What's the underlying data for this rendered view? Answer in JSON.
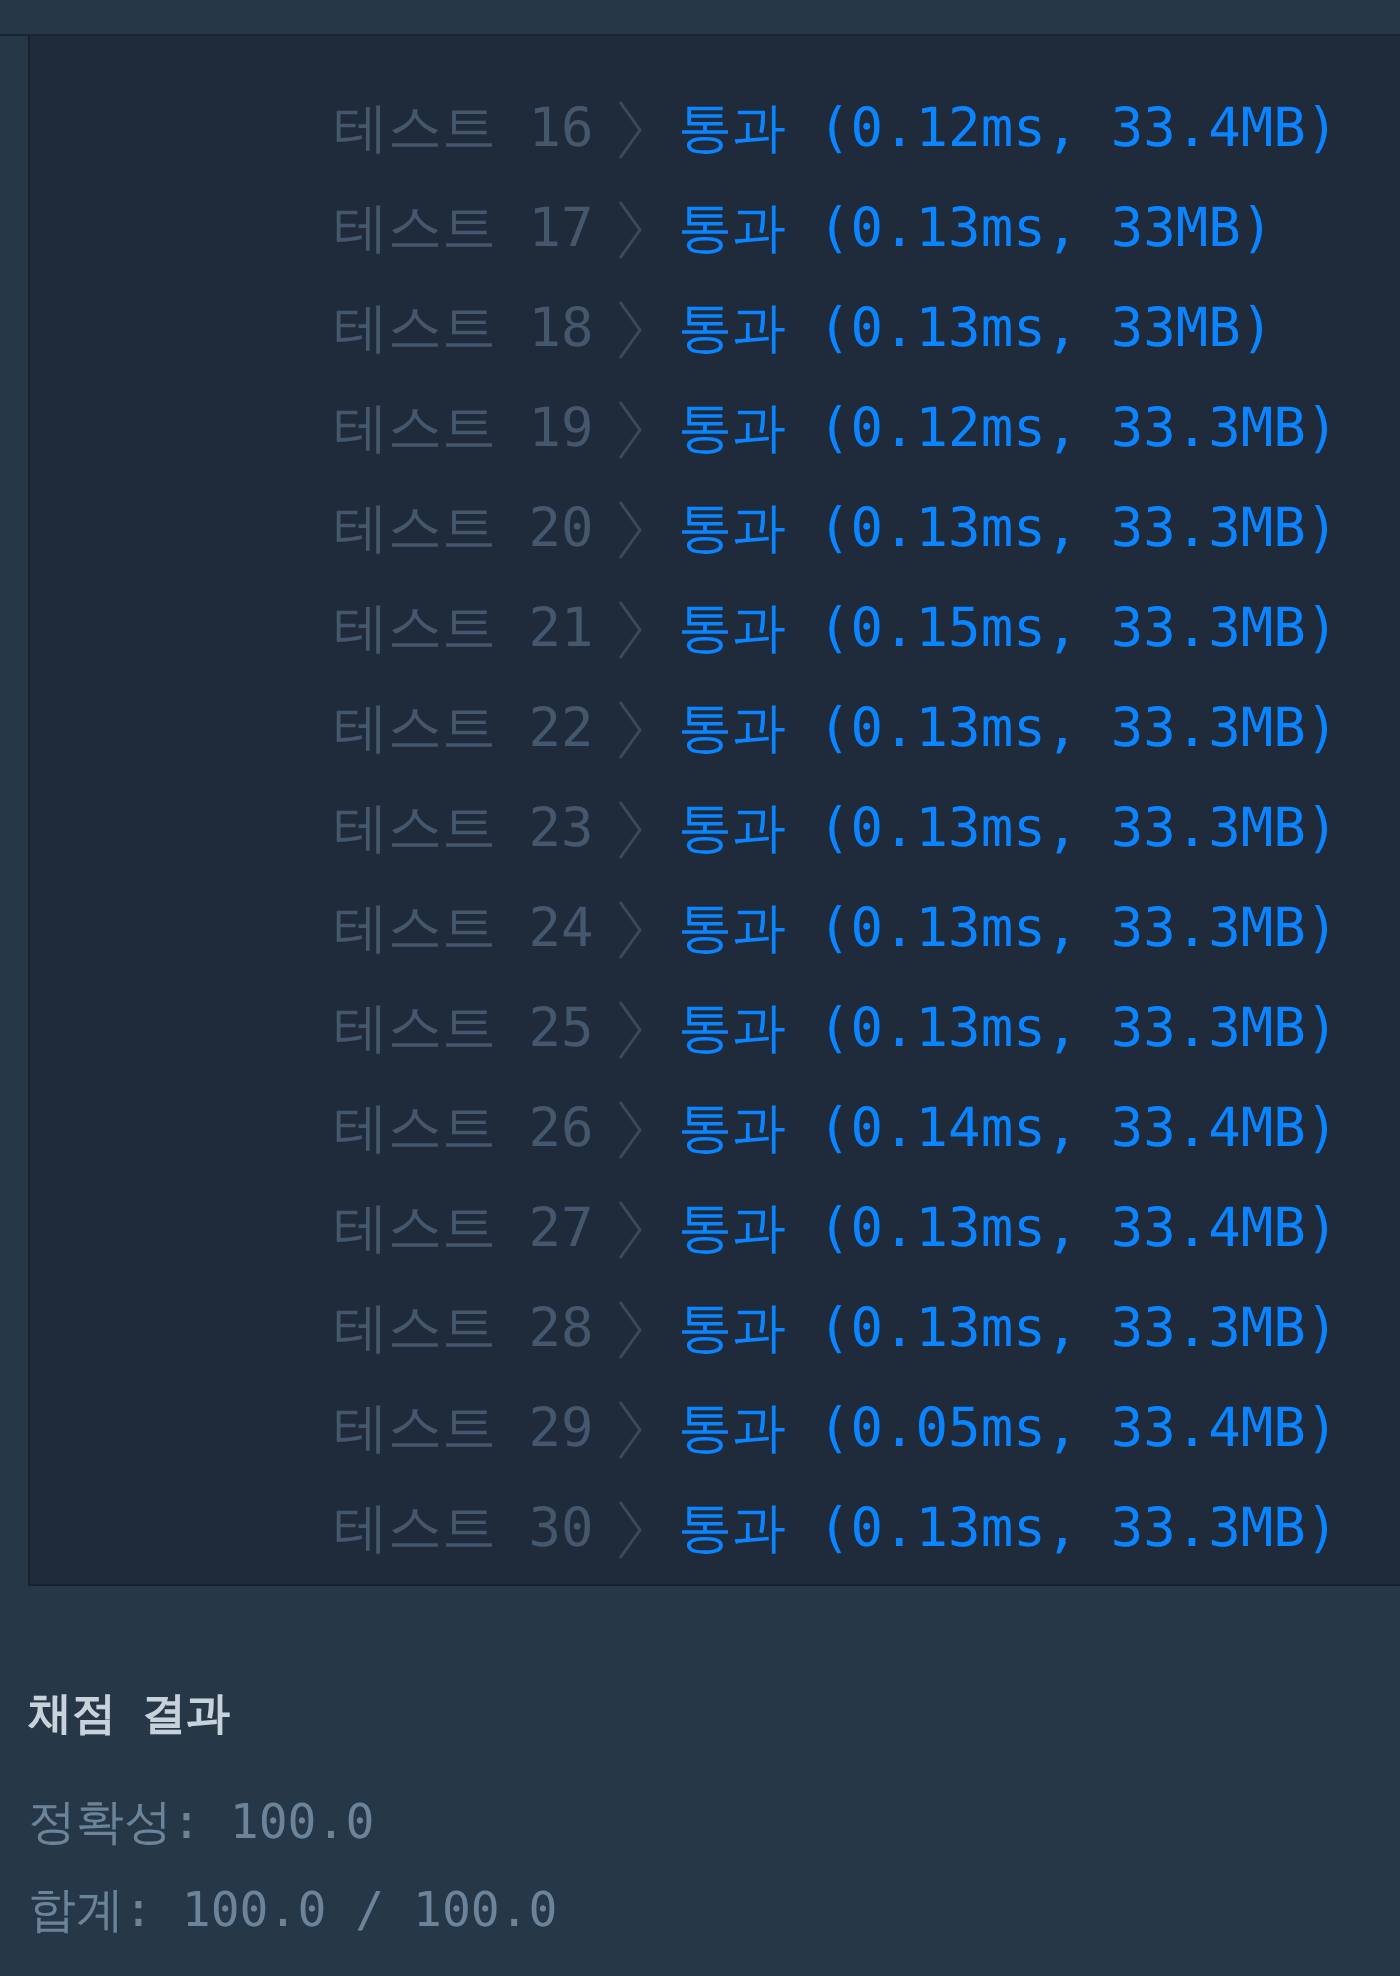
{
  "tests": [
    {
      "label": "테스트 16",
      "result": "통과 (0.12ms, 33.4MB)"
    },
    {
      "label": "테스트 17",
      "result": "통과 (0.13ms, 33MB)"
    },
    {
      "label": "테스트 18",
      "result": "통과 (0.13ms, 33MB)"
    },
    {
      "label": "테스트 19",
      "result": "통과 (0.12ms, 33.3MB)"
    },
    {
      "label": "테스트 20",
      "result": "통과 (0.13ms, 33.3MB)"
    },
    {
      "label": "테스트 21",
      "result": "통과 (0.15ms, 33.3MB)"
    },
    {
      "label": "테스트 22",
      "result": "통과 (0.13ms, 33.3MB)"
    },
    {
      "label": "테스트 23",
      "result": "통과 (0.13ms, 33.3MB)"
    },
    {
      "label": "테스트 24",
      "result": "통과 (0.13ms, 33.3MB)"
    },
    {
      "label": "테스트 25",
      "result": "통과 (0.13ms, 33.3MB)"
    },
    {
      "label": "테스트 26",
      "result": "통과 (0.14ms, 33.4MB)"
    },
    {
      "label": "테스트 27",
      "result": "통과 (0.13ms, 33.4MB)"
    },
    {
      "label": "테스트 28",
      "result": "통과 (0.13ms, 33.3MB)"
    },
    {
      "label": "테스트 29",
      "result": "통과 (0.05ms, 33.4MB)"
    },
    {
      "label": "테스트 30",
      "result": "통과 (0.13ms, 33.3MB)"
    }
  ],
  "grading": {
    "title": "채점 결과",
    "lines": [
      "정확성: 100.0",
      "합계: 100.0 / 100.0"
    ]
  }
}
